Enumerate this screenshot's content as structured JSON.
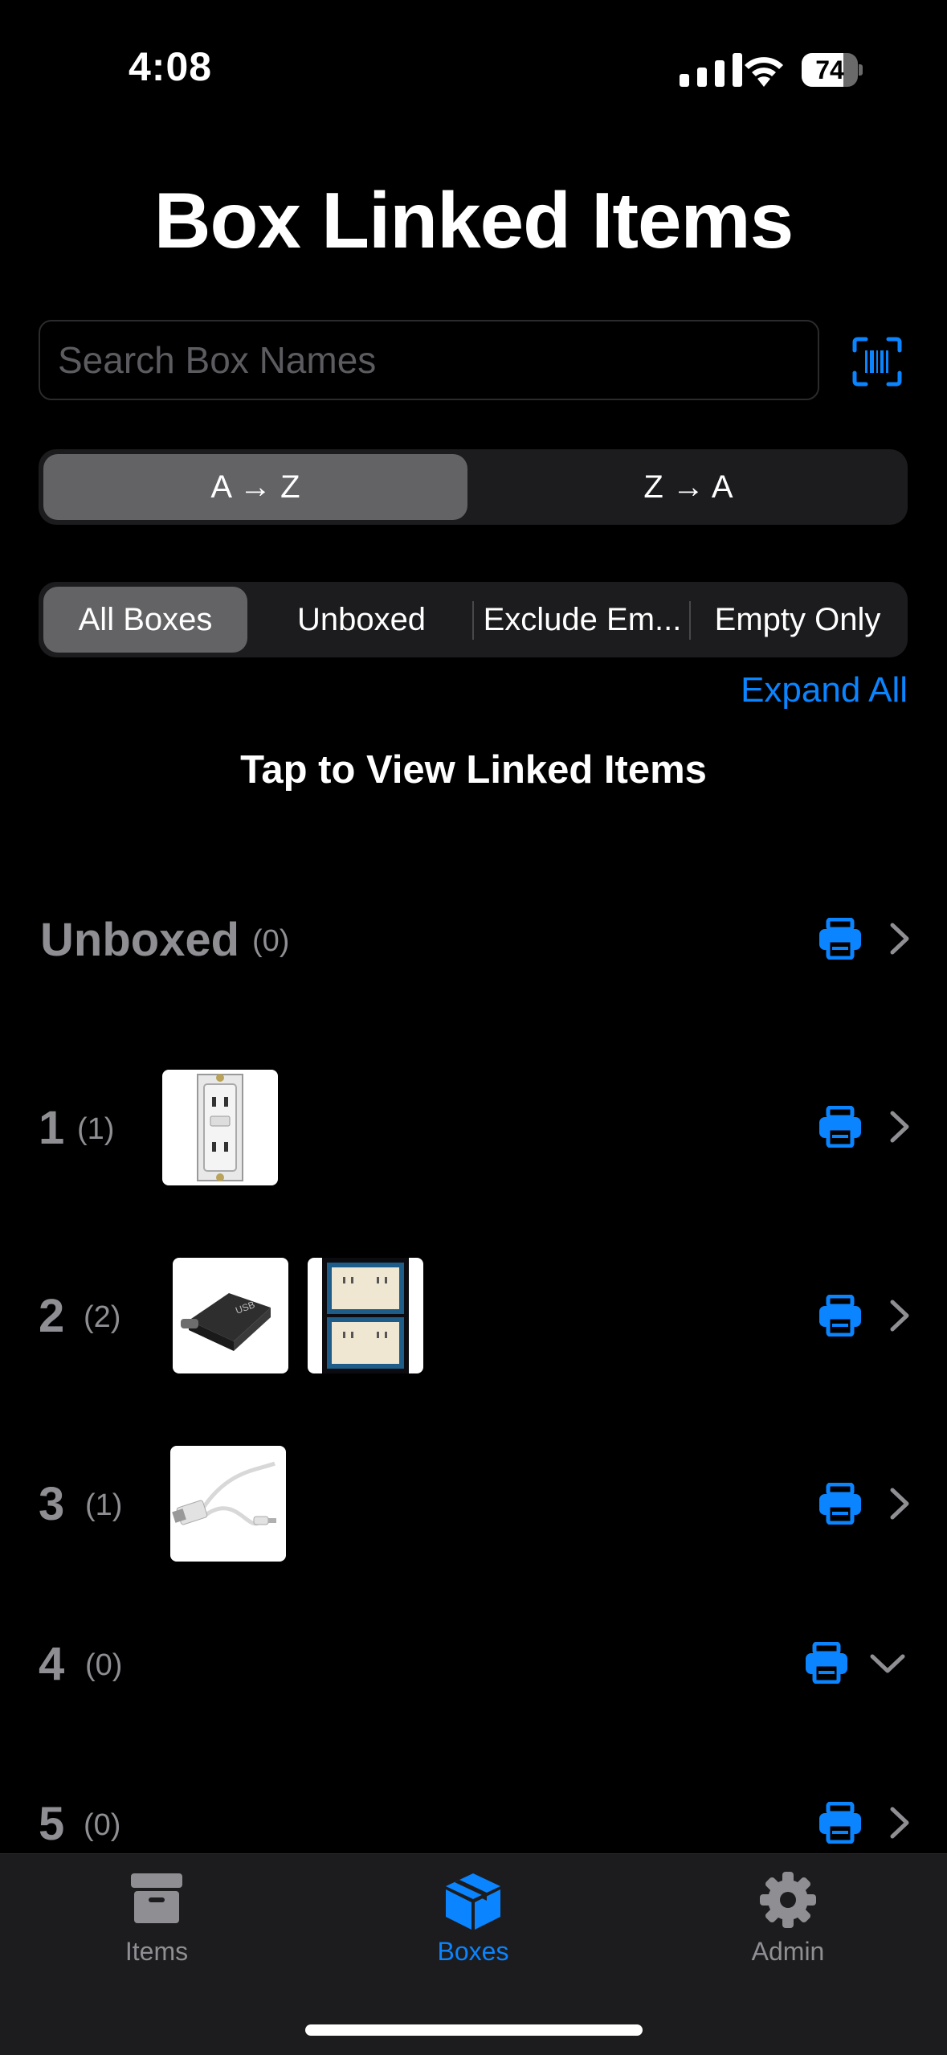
{
  "status_bar": {
    "time": "4:08",
    "battery": "74",
    "battery_level": 0.74
  },
  "title": "Box Linked Items",
  "search": {
    "placeholder": "Search Box Names",
    "value": ""
  },
  "sort": {
    "options": [
      "A → Z",
      "Z → A"
    ],
    "selected": "A → Z"
  },
  "filter": {
    "options": [
      "All Boxes",
      "Unboxed",
      "Exclude Em...",
      "Empty Only"
    ],
    "selected": "All Boxes"
  },
  "expand_all": "Expand All",
  "hint": "Tap to View Linked Items",
  "boxes": [
    {
      "name": "Unboxed",
      "count": "(0)",
      "thumbs": [],
      "expanded": false
    },
    {
      "name": "1",
      "count": "(1)",
      "thumbs": [
        "gfci-outlet"
      ],
      "expanded": false
    },
    {
      "name": "2",
      "count": "(2)",
      "thumbs": [
        "usb-c-adapter",
        "outlet-splitters"
      ],
      "expanded": false
    },
    {
      "name": "3",
      "count": "(1)",
      "thumbs": [
        "lightning-cable"
      ],
      "expanded": false
    },
    {
      "name": "4",
      "count": "(0)",
      "thumbs": [],
      "expanded": true
    },
    {
      "name": "5",
      "count": "(0)",
      "thumbs": [],
      "expanded": false
    }
  ],
  "tabs": [
    {
      "label": "Items",
      "icon": "archive-box-icon",
      "active": false
    },
    {
      "label": "Boxes",
      "icon": "cube-icon",
      "active": true
    },
    {
      "label": "Admin",
      "icon": "gear-icon",
      "active": false
    }
  ],
  "colors": {
    "accent": "#0a84ff",
    "muted": "#8e8e93",
    "segment_bg": "#1c1c1e",
    "segment_sel": "#636366"
  }
}
